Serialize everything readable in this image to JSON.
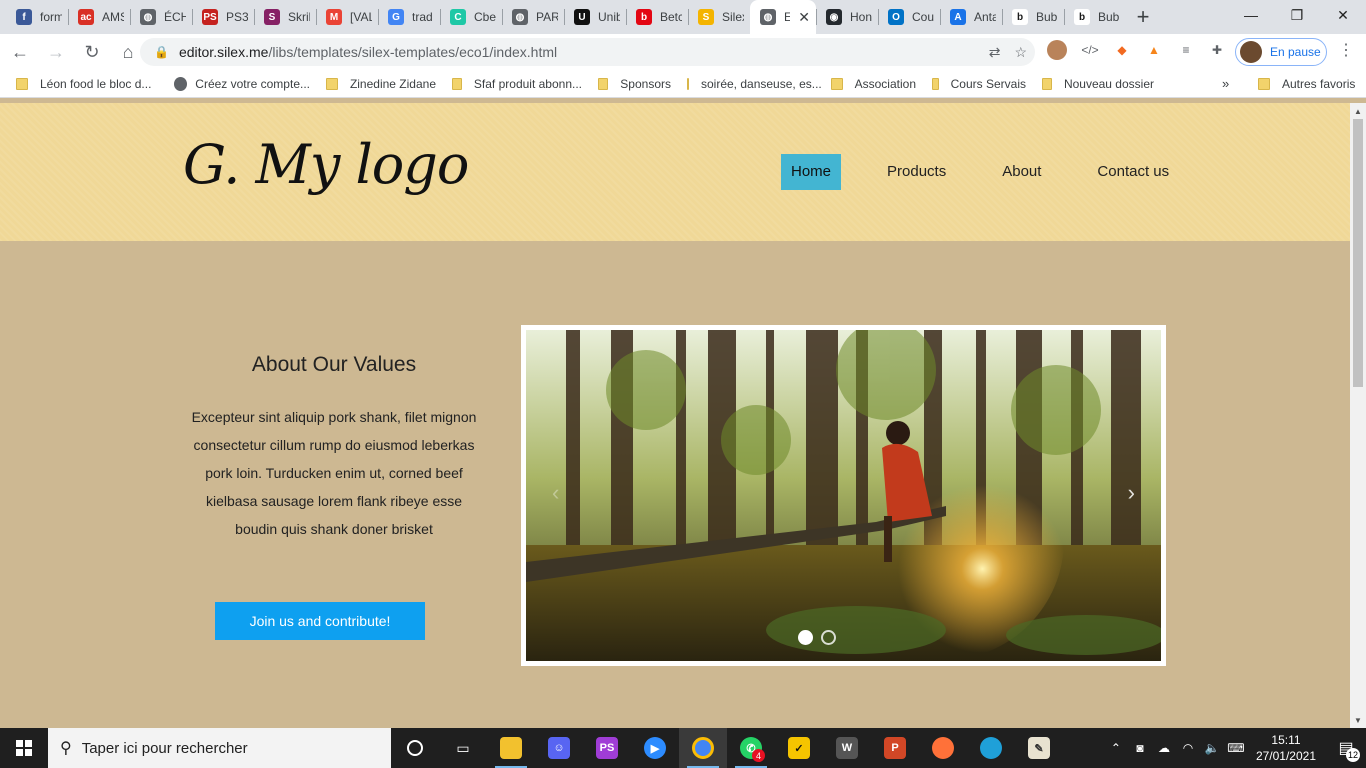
{
  "browser": {
    "tabs": [
      {
        "label": "form",
        "icon": "form-favicon",
        "color": "#3b5998",
        "glyph": "f"
      },
      {
        "label": "AMS",
        "icon": "ams-favicon",
        "color": "#d93025",
        "glyph": "ac"
      },
      {
        "label": "ÉCH",
        "icon": "globe-favicon",
        "color": "#5f6368",
        "glyph": "◍"
      },
      {
        "label": "PS3",
        "icon": "ps-favicon",
        "color": "#c5221f",
        "glyph": "PS"
      },
      {
        "label": "Skril",
        "icon": "skrill-favicon",
        "color": "#862165",
        "glyph": "S"
      },
      {
        "label": "[VAL",
        "icon": "gmail-favicon",
        "color": "#ea4335",
        "glyph": "M"
      },
      {
        "label": "trad",
        "icon": "google-favicon",
        "color": "#4285f4",
        "glyph": "G"
      },
      {
        "label": "Cbe",
        "icon": "cbe-favicon",
        "color": "#1ec8a6",
        "glyph": "C"
      },
      {
        "label": "PAR",
        "icon": "globe-favicon",
        "color": "#5f6368",
        "glyph": "◍"
      },
      {
        "label": "Unib",
        "icon": "unibet-favicon",
        "color": "#111111",
        "glyph": "U"
      },
      {
        "label": "Betc",
        "icon": "betclic-favicon",
        "color": "#e30613",
        "glyph": "b"
      },
      {
        "label": "Silex",
        "icon": "silex-favicon",
        "color": "#f4b400",
        "glyph": "S"
      },
      {
        "label": "E",
        "icon": "globe-favicon",
        "color": "#5f6368",
        "glyph": "◍",
        "active": true
      },
      {
        "label": "Hon",
        "icon": "github-favicon",
        "color": "#24292e",
        "glyph": "◉"
      },
      {
        "label": "Cou",
        "icon": "outlook-favicon",
        "color": "#0072c6",
        "glyph": "O"
      },
      {
        "label": "Anta",
        "icon": "anta-favicon",
        "color": "#1a73e8",
        "glyph": "A"
      },
      {
        "label": "Bubl",
        "icon": "bubble-favicon",
        "color": "#ffffff",
        "glyph": "b"
      },
      {
        "label": "Bubl",
        "icon": "bubble-favicon",
        "color": "#ffffff",
        "glyph": "b"
      }
    ],
    "url_host": "editor.silex.me",
    "url_path": "/libs/templates/silex-templates/eco1/index.html",
    "profile_label": "En pause",
    "bookmarks": [
      {
        "label": "Léon food le bloc d...",
        "type": "folder"
      },
      {
        "label": "Créez votre compte...",
        "type": "site"
      },
      {
        "label": "Zinedine Zidane",
        "type": "folder"
      },
      {
        "label": "Sfaf produit abonn...",
        "type": "folder"
      },
      {
        "label": "Sponsors",
        "type": "folder"
      },
      {
        "label": "soirée, danseuse, es...",
        "type": "folder"
      },
      {
        "label": "Association",
        "type": "folder"
      },
      {
        "label": "Cours Servais",
        "type": "folder"
      },
      {
        "label": "Nouveau dossier",
        "type": "folder"
      }
    ],
    "bookmarks_more": "»",
    "other_bookmarks": "Autres favoris"
  },
  "site": {
    "logo": "G. My logo",
    "nav": [
      "Home",
      "Products",
      "About",
      "Contact us"
    ],
    "values_title": "About Our Values",
    "values_text": "Excepteur sint aliquip pork shank, filet mignon consectetur cillum rump do eiusmod leberkas pork loin. Turducken enim ut, corned beef kielbasa sausage lorem flank ribeye esse boudin quis shank doner brisket",
    "cta": "Join us and contribute!",
    "slider": {
      "current": 1,
      "total": 2,
      "prev": "‹",
      "next": "›"
    },
    "colors": {
      "header": "#f0d897",
      "content": "#cdb892",
      "nav_active": "#43b5d2",
      "cta": "#0ea0f0"
    }
  },
  "taskbar": {
    "search_placeholder": "Taper ici pour rechercher",
    "whatsapp_badge": "4",
    "time": "15:11",
    "date": "27/01/2021",
    "notifications": "12"
  }
}
